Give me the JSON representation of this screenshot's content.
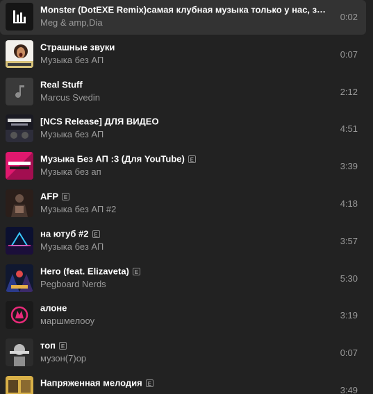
{
  "tracks": [
    {
      "title": "Monster (DotEXE Remix)самая клубная музыка только у нас, захо...",
      "artist": "Meg & amp,Dia",
      "duration": "0:02",
      "explicit": false,
      "cover_icon": "equalizer-icon",
      "active": true
    },
    {
      "title": "Страшные звуки",
      "artist": "Музыка без АП",
      "duration": "0:07",
      "explicit": false,
      "cover_icon": "cover-art-image"
    },
    {
      "title": "Real Stuff",
      "artist": "Marcus Svedin",
      "duration": "2:12",
      "explicit": false,
      "cover_icon": "music-note-icon"
    },
    {
      "title": "[NCS Release] ДЛЯ ВИДЕО",
      "artist": "Музыка без АП",
      "duration": "4:51",
      "explicit": false,
      "cover_icon": "cover-art-image"
    },
    {
      "title": "Музыка Без АП :3 (Для YouTube)",
      "artist": "Музыка без ап",
      "duration": "3:39",
      "explicit": true,
      "cover_icon": "cover-art-image"
    },
    {
      "title": "AFP",
      "artist": "Музыка без АП #2",
      "duration": "4:18",
      "explicit": true,
      "cover_icon": "cover-art-image"
    },
    {
      "title": "на ютуб #2",
      "artist": "Музыка без АП",
      "duration": "3:57",
      "explicit": true,
      "cover_icon": "cover-art-image"
    },
    {
      "title": "Hero (feat. Elizaveta)",
      "artist": "Pegboard Nerds",
      "duration": "5:30",
      "explicit": true,
      "cover_icon": "cover-art-image"
    },
    {
      "title": "алоне",
      "artist": "маршмелооу",
      "duration": "3:19",
      "explicit": false,
      "cover_icon": "cover-art-image"
    },
    {
      "title": "топ",
      "artist": "музон(7)ор",
      "duration": "0:07",
      "explicit": true,
      "cover_icon": "cover-art-image"
    },
    {
      "title": "Напряженная мелодия",
      "artist": "",
      "duration": "3:49",
      "explicit": true,
      "cover_icon": "cover-art-image"
    }
  ],
  "explicit_badge": "E",
  "colors": {
    "background": "#222222",
    "active_row": "#333333",
    "title": "#ffffff",
    "secondary": "#9b9b9b"
  }
}
